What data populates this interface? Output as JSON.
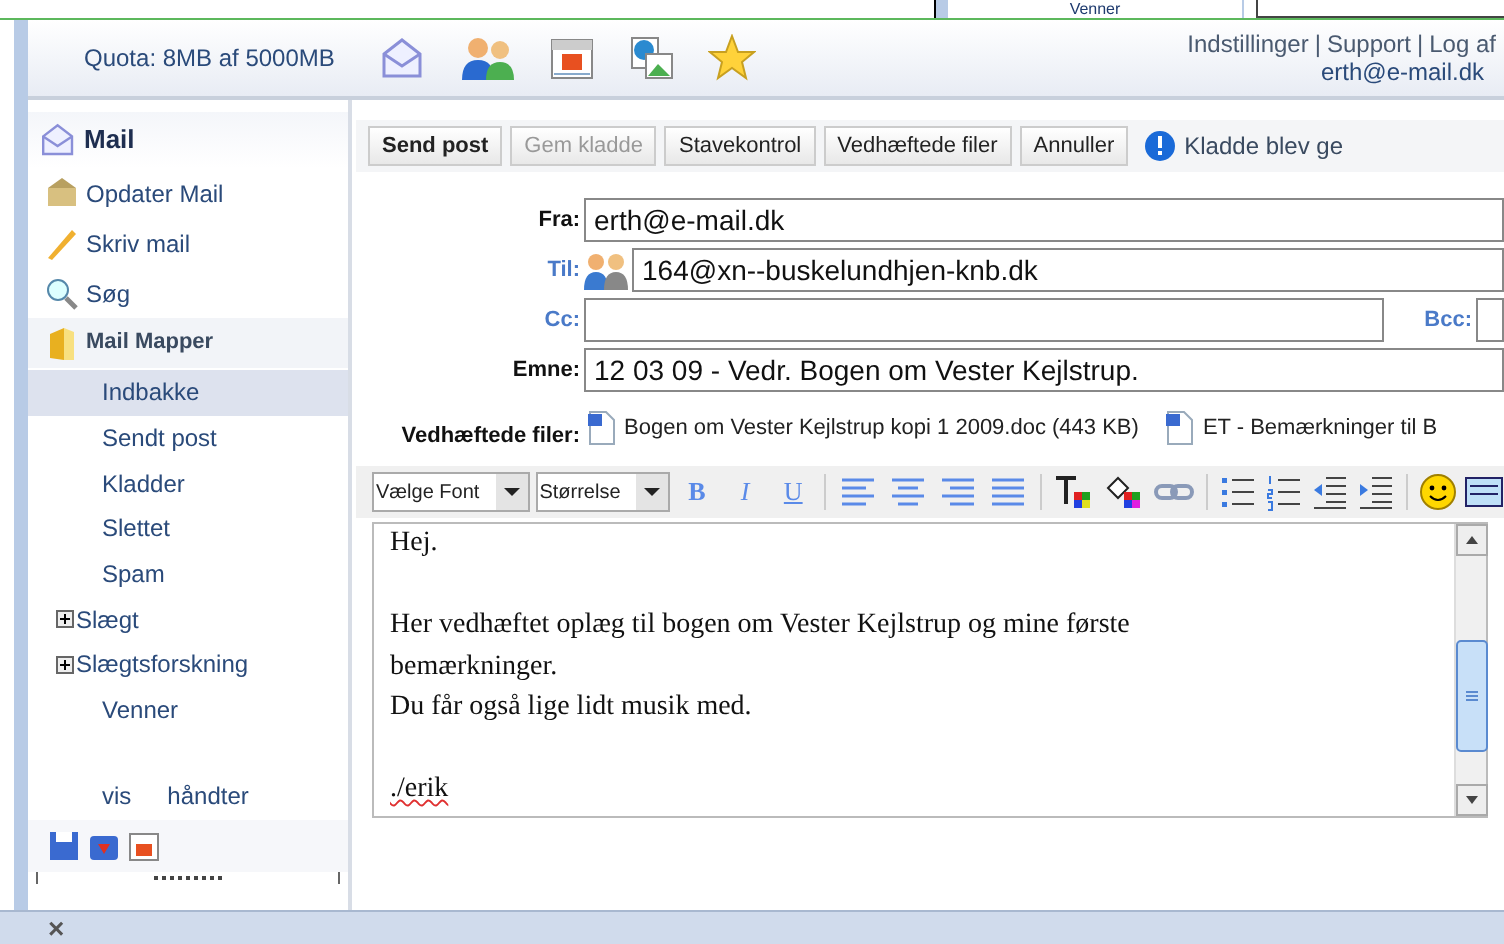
{
  "background_window": {
    "text": "Venner"
  },
  "header": {
    "quota": "Quota: 8MB af 5000MB",
    "links": [
      "Indstillinger",
      "Support",
      "Log af"
    ],
    "separator": "|",
    "user": "erth@e-mail.dk"
  },
  "sidebar": {
    "title": "Mail",
    "actions": [
      {
        "kind": "update",
        "label": "Opdater Mail"
      },
      {
        "kind": "write",
        "label": "Skriv mail"
      },
      {
        "kind": "search",
        "label": "Søg"
      }
    ],
    "folders_title": "Mail Mapper",
    "folders": [
      {
        "label": "Indbakke",
        "selected": true,
        "expandable": false
      },
      {
        "label": "Sendt post",
        "selected": false,
        "expandable": false
      },
      {
        "label": "Kladder",
        "selected": false,
        "expandable": false
      },
      {
        "label": "Slettet",
        "selected": false,
        "expandable": false
      },
      {
        "label": "Spam",
        "selected": false,
        "expandable": false
      },
      {
        "label": "Slægt",
        "selected": false,
        "expandable": true
      },
      {
        "label": "Slægtsforskning",
        "selected": false,
        "expandable": true
      },
      {
        "label": "Venner",
        "selected": false,
        "expandable": false
      }
    ],
    "footer_links": [
      "vis",
      "håndter"
    ]
  },
  "toolbar": {
    "buttons": [
      {
        "label": "Send post",
        "disabled": false,
        "bold": true
      },
      {
        "label": "Gem kladde",
        "disabled": true,
        "bold": false
      },
      {
        "label": "Stavekontrol",
        "disabled": false,
        "bold": false
      },
      {
        "label": "Vedhæftede filer",
        "disabled": false,
        "bold": false
      },
      {
        "label": "Annuller",
        "disabled": false,
        "bold": false
      }
    ],
    "notice": "Kladde blev ge"
  },
  "form": {
    "from_label": "Fra:",
    "from": "erth@e-mail.dk",
    "to_label": "Til:",
    "to": "164@xn--buskelundhjen-knb.dk",
    "cc_label": "Cc:",
    "bcc_label": "Bcc:",
    "subject_label": "Emne:",
    "subject": "12 03 09 - Vedr. Bogen om Vester Kejlstrup.",
    "attachments_label": "Vedhæftede filer:",
    "attachments": [
      "Bogen om Vester Kejlstrup kopi 1 2009.doc (443 KB)",
      "ET - Bemærkninger til B"
    ]
  },
  "editor": {
    "font_select": "Vælge Font",
    "size_select": "Størrelse",
    "format_buttons": [
      {
        "kind": "bold",
        "label": "B"
      },
      {
        "kind": "italic",
        "label": "I"
      },
      {
        "kind": "underline",
        "label": "U"
      }
    ],
    "paragraphs": [
      {
        "lines": [
          "Hej."
        ]
      },
      {
        "lines": [
          "Her vedhæftet oplæg til bogen om Vester Kejlstrup og mine første bemærkninger.",
          "Du får også lige lidt musik med."
        ]
      },
      {
        "lines": [
          "./erik"
        ]
      }
    ]
  },
  "status_bar": {
    "close": "×"
  }
}
